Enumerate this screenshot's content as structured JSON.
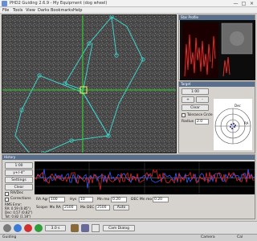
{
  "window": {
    "title": "PHD2 Guiding 2.6.9 - My Equipment (dog wheel)",
    "btn_min": "—",
    "btn_max": "□",
    "btn_close": "×"
  },
  "menu": [
    "File",
    "Tools",
    "View",
    "Darks",
    "Bookmarks",
    "Help"
  ],
  "fov_panel": {
    "title": "Star Profile"
  },
  "rms_panel": {
    "title": "Target",
    "btn_top": "1:00",
    "btn_zoom_in": "+",
    "btn_zoom_out": "-",
    "btn_clear": "Clear",
    "tolerance_label": "Tolerance Circle",
    "radius_label": "Radius",
    "radius_value": "2.0",
    "compass": {
      "n": "Dec",
      "e": "RA"
    }
  },
  "graph_panel": {
    "title": "History",
    "left_buttons": [
      "1:00",
      "y+/-4\"",
      "Settings",
      "Clear"
    ],
    "legend": [
      "RA/Dec",
      "Corrections"
    ],
    "rms_text": [
      "RMS Error:",
      "RA: 0.59 (0.85\")",
      "Dec: 0.57 (0.82\")",
      "Tot: 0.82 (1.18\")"
    ],
    "params": {
      "ra_agr_label": "RA Agr",
      "ra_agr_value": "100",
      "ra_hys_label": "Hys",
      "ra_hys_value": "10",
      "ra_mnmo_label": "Mn mo",
      "ra_mnmo_value": "0.20",
      "dec_mnmo_label": "DEC Mn mo",
      "dec_mnmo_value": "0.20",
      "max_ra_label": "Scope: Mx RA",
      "max_ra_value": "2500",
      "max_dec_label": "Mx DEC",
      "max_dec_value": "2500",
      "dec_mode": "Auto"
    }
  },
  "toolbar": {
    "exposure": "3.0 s",
    "cam_dialog": "Cam Dialog"
  },
  "status": {
    "left": "Guiding",
    "mid": "Camera",
    "right": "Cal"
  }
}
